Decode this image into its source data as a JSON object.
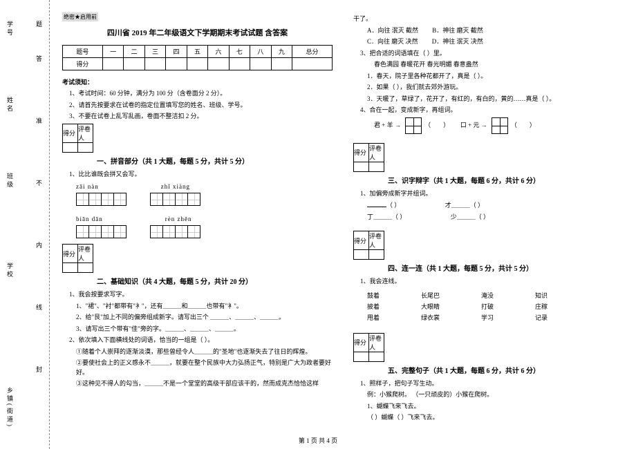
{
  "secret": "绝密★启用前",
  "title": "四川省 2019 年二年级语文下学期期末考试试题 含答案",
  "margin": {
    "l1": "学号",
    "l2": "姓名",
    "l3": "班级",
    "l4": "学校",
    "l5": "乡镇(街道)",
    "i1": "答",
    "i2": "准",
    "i3": "不",
    "i4": "内",
    "i5": "线",
    "i6": "封",
    "i7": "题"
  },
  "scoreTable": {
    "row1": [
      "题号",
      "一",
      "二",
      "三",
      "四",
      "五",
      "六",
      "七",
      "八",
      "九",
      "总分"
    ],
    "row2": "得分"
  },
  "notice": {
    "head": "考试须知：",
    "n1": "1、考试时间：60 分钟，满分为 100 分（含卷面分 2 分）。",
    "n2": "2、请首先按要求在试卷的指定位置填写您的姓名、班级、学号。",
    "n3": "3、不要在试卷上乱写乱画，卷面不整洁扣 2 分。"
  },
  "miniHead": {
    "c1": "得分",
    "c2": "评卷人"
  },
  "sec1": {
    "title": "一、拼音部分（共 1 大题，每题 5 分，共计 5 分）",
    "q1": "1、比比谁既会拼又会写。",
    "p1": "zāi nàn",
    "p2": "zhǐ xiàng",
    "p3": "biān dān",
    "p4": "rèn zhēn"
  },
  "sec2": {
    "title": "二、基础知识（共 4 大题，每题 5 分，共计 20 分）",
    "q1": "1、我会按要求写字。",
    "l1": "1、\"裙\"、\"衬\"都带有\"衤\"，还有＿＿＿和＿＿＿也带有\"衤\"。",
    "l2": "2、给\"艮\"加上不同的偏旁组成新字。请写出三个 ＿＿＿、＿＿＿、＿＿＿。",
    "l3": "3、请写出三个带有\"佳\"旁的字。＿＿＿、＿＿＿、＿＿＿。",
    "q2": "2、依次填入下面横线处的词语，恰当的一组是（       ）。",
    "t2": "①随着个人崇拜的逐渐淡漠，那些曾经令人＿＿＿的\"圣地\"也逐渐失去了往日的辉煌。",
    "t2b": "②要使社会上的正义感永不＿＿＿，就要在整个民族中大力弘扬正气，特别是广大为政者要好好。",
    "t2c": "③这种见不得人的勾当，＿＿＿不是一个堂堂的高级干部应该干的，然而成克杰恰恰这样"
  },
  "right": {
    "top": "干了。",
    "optA": "A．向往    泯灭    截然",
    "optB": "B．神往    磨灭    截然",
    "optC": "C．向往    磨灭    决然",
    "optD": "D．神往    泯灭    决然",
    "q3": "3、把合适的词语填在（        ）里。",
    "w": "春色满园        春暖花开        春光明媚        春意盎然",
    "w1": "1．春天，院子里各种花都开了，真是（            ）。",
    "w2": "2．如果（            ），我们就去郊外游玩。",
    "w3": "3．天暖了，草绿了，花开了，有红的，有白的，黄的……真是（                    ）。",
    "q4": "4、合在一起，变成新字，再组词。",
    "z1": "君 + 羊 →",
    "z2": "口 + 元 →"
  },
  "sec3": {
    "title": "三、识字辩字（共 1 大题，每题 6 分，共计 6 分）",
    "q1": "1、加偏旁成新字并组词。",
    "r1l": "（            ）",
    "r1r": "才＿＿＿（            ）",
    "r2l": "丁＿＿＿（            ）",
    "r2r": "少＿＿＿（            ）"
  },
  "sec4": {
    "title": "四、连一连（共 1 大题，每题 5 分，共计 5 分）",
    "q1": "1、我会连线。",
    "left": [
      "鼓着",
      "披着",
      "甩着"
    ],
    "mid": [
      "长尾巴",
      "大眼睛",
      "绿衣裳"
    ],
    "r1": [
      "淹没",
      "打破",
      "学习"
    ],
    "r2": [
      "知识",
      "庄稼",
      "记录"
    ]
  },
  "sec5": {
    "title": "五、完整句子（共 1 大题，每题 6 分，共计 6 分）",
    "q1": "1、照样子，把句子写生动。",
    "ex": "例：小猴爬树。            （一只顽皮的）小猴在爬树。",
    "l1": "1、蝴蝶飞来飞去。",
    "l2": "（            ）蝴蝶（                              ）飞来飞去。"
  },
  "footer": "第 1 页 共 4 页"
}
